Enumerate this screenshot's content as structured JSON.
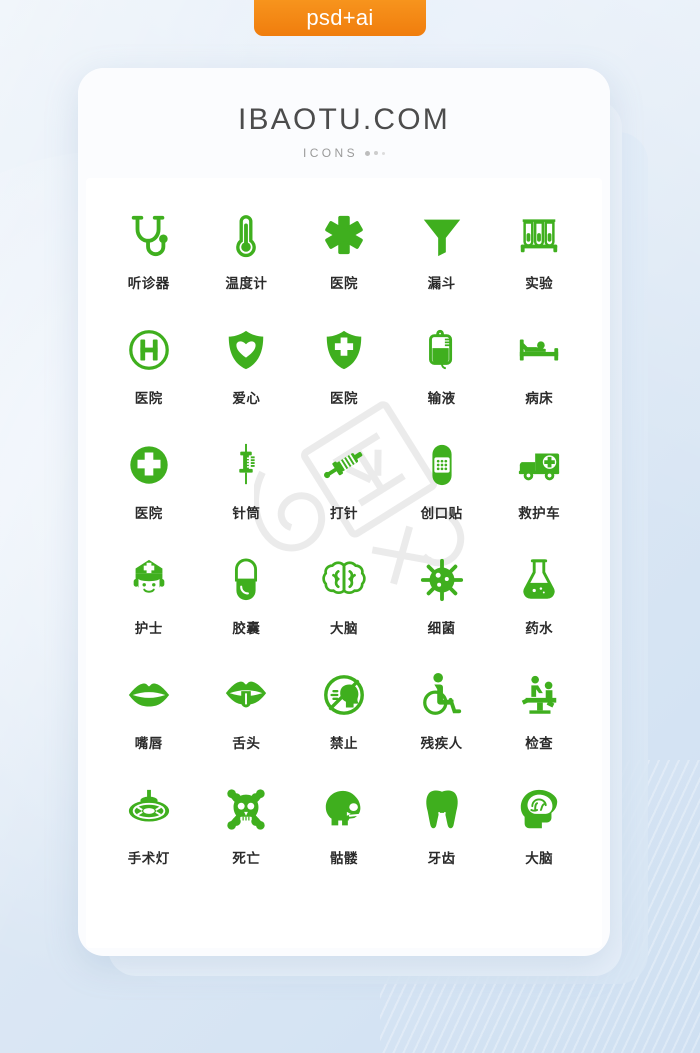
{
  "badge": {
    "label": "psd+ai",
    "color": "#f28c17"
  },
  "card": {
    "title": "IBAOTU.COM",
    "subtitle": "ICONS"
  },
  "theme": {
    "icon_green": "#3FAF1E",
    "label_color": "#2b2b2b",
    "background": "#dce8f5",
    "card_background": "#fbfcfe"
  },
  "watermark": {
    "text": "6 图"
  },
  "grid": {
    "columns": 5,
    "rows": 6,
    "items": [
      {
        "label": "听诊器",
        "icon": "stethoscope-icon"
      },
      {
        "label": "温度计",
        "icon": "thermometer-icon"
      },
      {
        "label": "医院",
        "icon": "star-of-life-icon"
      },
      {
        "label": "漏斗",
        "icon": "funnel-icon"
      },
      {
        "label": "实验",
        "icon": "test-tubes-icon"
      },
      {
        "label": "医院",
        "icon": "hospital-h-circle-icon"
      },
      {
        "label": "爱心",
        "icon": "shield-heart-icon"
      },
      {
        "label": "医院",
        "icon": "shield-cross-icon"
      },
      {
        "label": "输液",
        "icon": "iv-drip-bag-icon"
      },
      {
        "label": "病床",
        "icon": "hospital-bed-icon"
      },
      {
        "label": "医院",
        "icon": "circle-cross-icon"
      },
      {
        "label": "针筒",
        "icon": "syringe-vertical-icon"
      },
      {
        "label": "打针",
        "icon": "syringe-injection-icon"
      },
      {
        "label": "创口贴",
        "icon": "bandage-icon"
      },
      {
        "label": "救护车",
        "icon": "ambulance-icon"
      },
      {
        "label": "护士",
        "icon": "nurse-icon"
      },
      {
        "label": "胶囊",
        "icon": "capsule-icon"
      },
      {
        "label": "大脑",
        "icon": "brain-outline-icon"
      },
      {
        "label": "细菌",
        "icon": "bacteria-icon"
      },
      {
        "label": "药水",
        "icon": "flask-icon"
      },
      {
        "label": "嘴唇",
        "icon": "lips-icon"
      },
      {
        "label": "舌头",
        "icon": "tongue-icon"
      },
      {
        "label": "禁止",
        "icon": "no-talking-icon"
      },
      {
        "label": "残疾人",
        "icon": "wheelchair-icon"
      },
      {
        "label": "检查",
        "icon": "examination-chair-icon"
      },
      {
        "label": "手术灯",
        "icon": "surgical-lamp-icon"
      },
      {
        "label": "死亡",
        "icon": "skull-crossbones-icon"
      },
      {
        "label": "骷髅",
        "icon": "skull-profile-icon"
      },
      {
        "label": "牙齿",
        "icon": "tooth-icon"
      },
      {
        "label": "大脑",
        "icon": "head-brain-icon"
      }
    ]
  }
}
